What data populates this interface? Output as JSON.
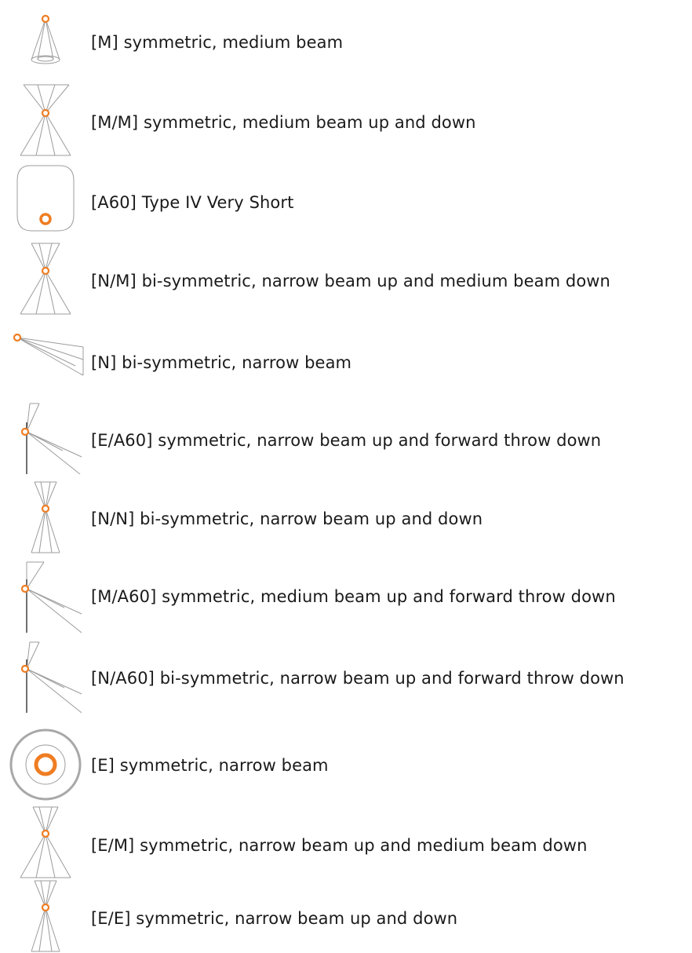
{
  "accent_color": "#ef7d22",
  "line_color": "#9c9c9c",
  "items": [
    {
      "icon": "medium-beam-cone-icon",
      "label": "[M] symmetric, medium beam"
    },
    {
      "icon": "medium-beam-up-down-icon",
      "label": "[M/M] symmetric, medium beam up and down"
    },
    {
      "icon": "type-iv-very-short-icon",
      "label": "[A60] Type IV Very Short"
    },
    {
      "icon": "narrow-up-medium-down-icon",
      "label": "[N/M] bi-symmetric, narrow beam up and medium beam down"
    },
    {
      "icon": "narrow-beam-angled-icon",
      "label": "[N] bi-symmetric, narrow beam"
    },
    {
      "icon": "narrow-up-forward-throw-icon",
      "label": "[E/A60] symmetric, narrow beam up and forward throw down"
    },
    {
      "icon": "narrow-up-down-icon",
      "label": "[N/N] bi-symmetric, narrow beam up and down"
    },
    {
      "icon": "medium-up-forward-throw-icon",
      "label": "[M/A60] symmetric, medium beam up and forward throw down"
    },
    {
      "icon": "narrow-up-forward-throw-bisym-icon",
      "label": "[N/A60] bi-symmetric, narrow beam up and forward throw down"
    },
    {
      "icon": "narrow-beam-circle-icon",
      "label": "[E] symmetric, narrow beam"
    },
    {
      "icon": "narrow-up-medium-down-e-icon",
      "label": "[E/M] symmetric, narrow beam up and medium beam down"
    },
    {
      "icon": "narrow-up-down-e-icon",
      "label": "[E/E] symmetric, narrow beam up and down"
    }
  ]
}
